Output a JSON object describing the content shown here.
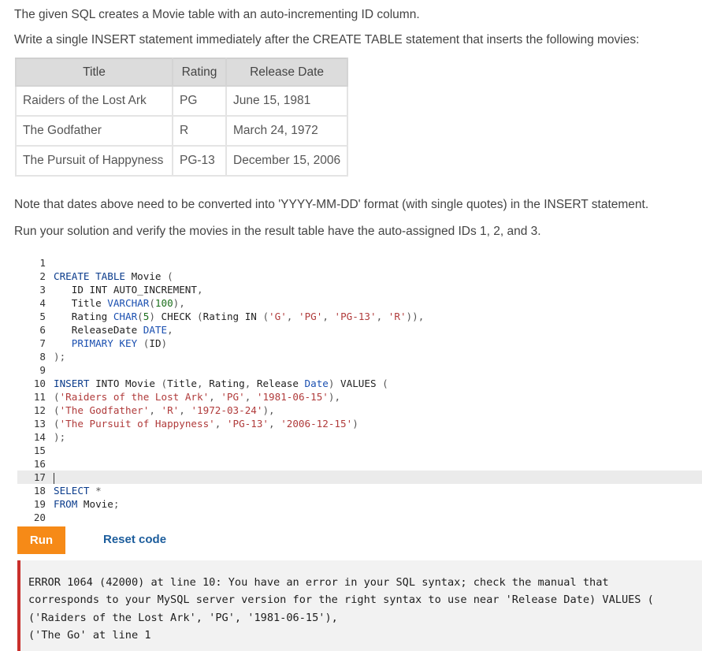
{
  "instructions": {
    "line1": "The given SQL creates a Movie table with an auto-incrementing ID column.",
    "line2": "Write a single INSERT statement immediately after the CREATE TABLE statement that inserts the following movies:",
    "note1": "Note that dates above need to be converted into 'YYYY-MM-DD' format (with single quotes) in the INSERT statement.",
    "note2": "Run your solution and verify the movies in the result table have the auto-assigned IDs 1, 2, and 3."
  },
  "movies_table": {
    "headers": [
      "Title",
      "Rating",
      "Release Date"
    ],
    "rows": [
      [
        "Raiders of the Lost Ark",
        "PG",
        "June 15, 1981"
      ],
      [
        "The Godfather",
        "R",
        "March 24, 1972"
      ],
      [
        "The Pursuit of Happyness",
        "PG-13",
        "December 15, 2006"
      ]
    ]
  },
  "editor": {
    "line_numbers": [
      "1",
      "2",
      "3",
      "4",
      "5",
      "6",
      "7",
      "8",
      "9",
      "10",
      "11",
      "12",
      "13",
      "14",
      "15",
      "16",
      "17",
      "18",
      "19",
      "20"
    ],
    "active_line": 17,
    "lines": [
      "",
      "CREATE TABLE Movie (",
      "   ID INT AUTO_INCREMENT,",
      "   Title VARCHAR(100),",
      "   Rating CHAR(5) CHECK (Rating IN ('G', 'PG', 'PG-13', 'R')),",
      "   ReleaseDate DATE,",
      "   PRIMARY KEY (ID)",
      ");",
      "",
      "INSERT INTO Movie (Title, Rating, Release Date) VALUES (",
      "('Raiders of the Lost Ark', 'PG', '1981-06-15'),",
      "('The Godfather', 'R', '1972-03-24'),",
      "('The Pursuit of Happyness', 'PG-13', '2006-12-15')",
      ");",
      "",
      "",
      "",
      "SELECT *",
      "FROM Movie;",
      ""
    ]
  },
  "actions": {
    "run_label": "Run",
    "reset_label": "Reset code"
  },
  "output": {
    "error_lines": [
      "ERROR 1064 (42000) at line 10: You have an error in your SQL syntax; check the manual that",
      "corresponds to your MySQL server version for the right syntax to use near 'Release Date) VALUES (",
      "('Raiders of the Lost Ark', 'PG', '1981-06-15'),",
      "('The Go' at line 1"
    ]
  },
  "colors": {
    "run_button": "#f68a17",
    "error_border": "#c9302c",
    "link": "#1c5d9c"
  }
}
